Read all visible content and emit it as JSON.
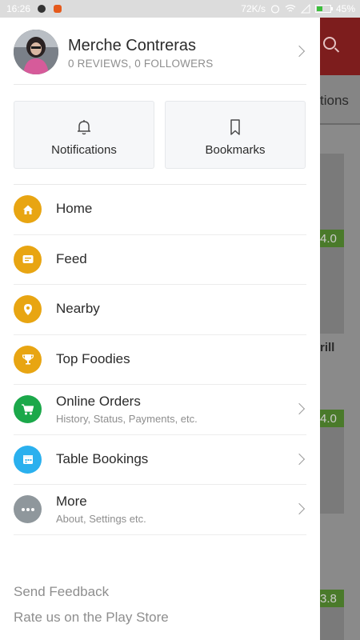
{
  "status_bar": {
    "time": "16:26",
    "network_speed": "72K/s",
    "battery_percent": "45%",
    "battery_level": 0.45
  },
  "profile": {
    "name": "Merche Contreras",
    "stats": "0 REVIEWS, 0 FOLLOWERS"
  },
  "quick_tiles": [
    {
      "label": "Notifications",
      "icon": "bell-icon"
    },
    {
      "label": "Bookmarks",
      "icon": "bookmark-icon"
    }
  ],
  "menu": [
    {
      "label": "Home",
      "icon": "home-icon",
      "color": "#e8a512"
    },
    {
      "label": "Feed",
      "icon": "feed-icon",
      "color": "#e8a512"
    },
    {
      "label": "Nearby",
      "icon": "location-pin-icon",
      "color": "#e8a512"
    },
    {
      "label": "Top Foodies",
      "icon": "trophy-icon",
      "color": "#e8a512"
    },
    {
      "label": "Online Orders",
      "sub": "History, Status, Payments, etc.",
      "icon": "cart-icon",
      "color": "#1ba84a"
    },
    {
      "label": "Table Bookings",
      "icon": "calendar-icon",
      "color": "#2ab0ee"
    },
    {
      "label": "More",
      "sub": "About, Settings etc.",
      "icon": "more-dots-icon",
      "color": "#8f979c"
    }
  ],
  "footer": {
    "feedback": "Send Feedback",
    "rate": "Rate us on the Play Store"
  },
  "background": {
    "tab_fragment": "tions",
    "ratings": [
      "4.0",
      "4.0",
      "3.8"
    ],
    "text_fragment": "rill"
  }
}
